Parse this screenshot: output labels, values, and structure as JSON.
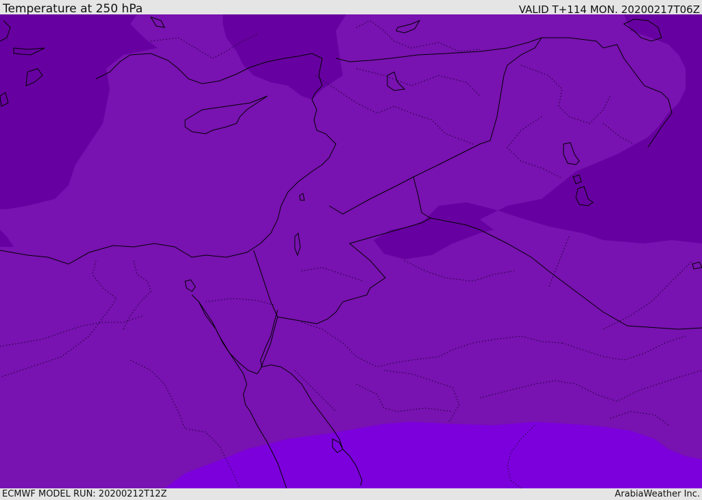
{
  "header": {
    "title": "Temperature at 250 hPa",
    "valid": "VALID T+114 MON. 20200217T06Z"
  },
  "footer": {
    "model_run": "ECMWF MODEL RUN: 20200212T12Z",
    "credit": "ArabiaWeather Inc."
  },
  "colors": {
    "mid_purple": "#7812b0",
    "dark_purple": "#6700a0",
    "violet": "#7c00dc",
    "coast": "#000000",
    "header_bg": "#e5e5e5"
  }
}
